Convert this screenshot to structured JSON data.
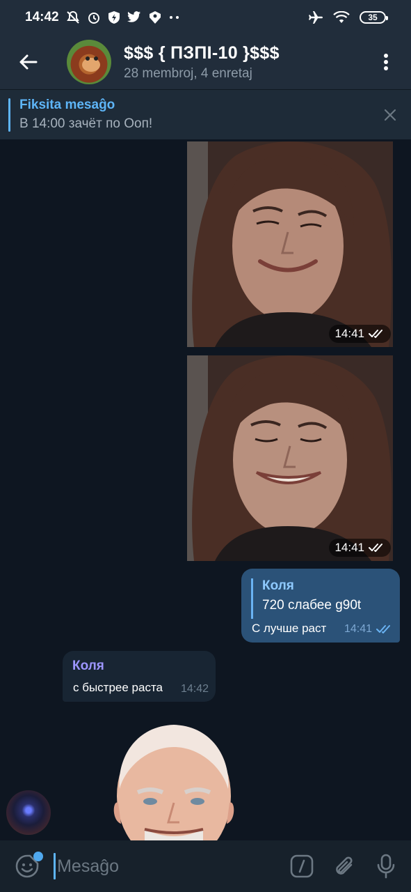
{
  "status_bar": {
    "time": "14:42",
    "battery": "35",
    "left_icons": [
      "bell-off-icon",
      "alarm-icon",
      "shield-icon",
      "twitter-icon",
      "vpn-icon",
      "more-dots-icon"
    ],
    "right_icons": [
      "airplane-icon",
      "wifi-icon",
      "battery-icon"
    ]
  },
  "header": {
    "title": "$$$ { ПЗПІ-10 }$$$",
    "subtitle": "28 membroj, 4 enretaj",
    "back_icon": "arrow-left-icon",
    "menu_icon": "more-vertical-icon"
  },
  "pinned": {
    "label": "Fiksita mesaĝo",
    "message": "В 14:00 зачёт по Ооп!",
    "close_icon": "close-icon"
  },
  "messages": [
    {
      "type": "photo",
      "direction": "out",
      "time": "14:41",
      "status": "read"
    },
    {
      "type": "photo",
      "direction": "out",
      "time": "14:41",
      "status": "read"
    },
    {
      "type": "text",
      "direction": "out",
      "reply": {
        "author": "Коля",
        "text": "720 слабее g90t"
      },
      "text": "С лучше раст",
      "time": "14:41",
      "status": "read"
    },
    {
      "type": "text",
      "direction": "in",
      "author": "Коля",
      "text": "с быстрее раста",
      "time": "14:42"
    },
    {
      "type": "sticker",
      "direction": "in"
    }
  ],
  "input": {
    "placeholder": "Mesaĝo",
    "value": "",
    "icons": [
      "sticker-icon",
      "bot-command-icon",
      "attach-icon",
      "microphone-icon"
    ]
  },
  "colors": {
    "header_bg": "#212d3b",
    "chat_bg": "#0e1621",
    "accent": "#5eb5f7",
    "outgoing_bubble": "#2b5278",
    "incoming_bubble": "#182533",
    "incoming_author": "#9d96ff"
  }
}
